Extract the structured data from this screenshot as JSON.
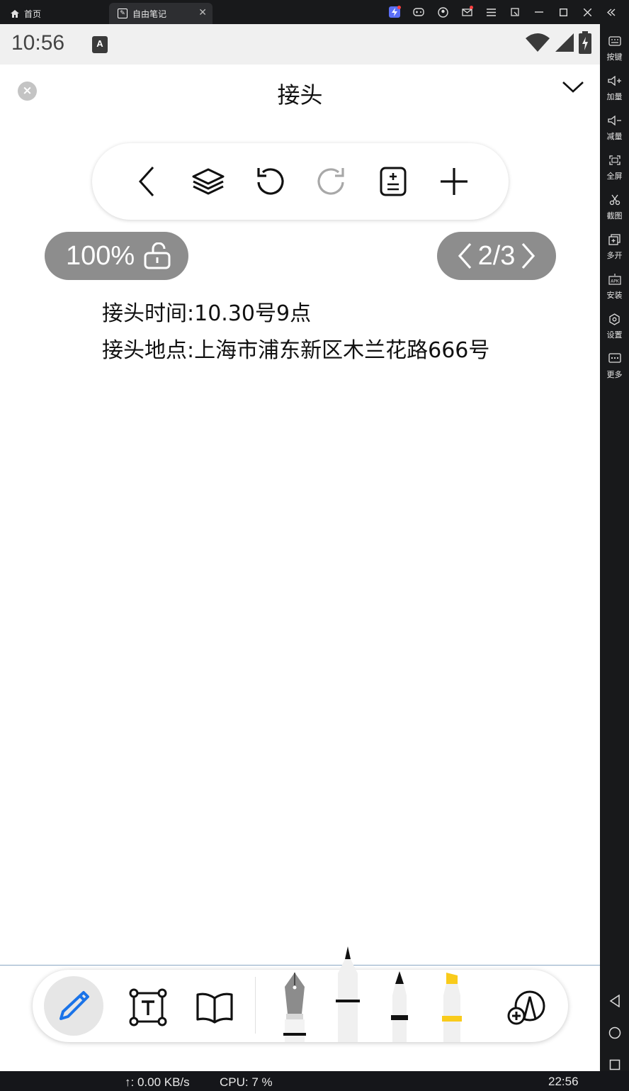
{
  "emulator": {
    "tabs": [
      {
        "label": "首页"
      },
      {
        "label": "自由笔记",
        "close": "✕"
      }
    ],
    "sidebar": [
      {
        "label": "按键",
        "icon": "keyboard-icon"
      },
      {
        "label": "加量",
        "icon": "volume-up-icon"
      },
      {
        "label": "减量",
        "icon": "volume-down-icon"
      },
      {
        "label": "全屏",
        "icon": "fullscreen-icon"
      },
      {
        "label": "截图",
        "icon": "scissors-icon"
      },
      {
        "label": "多开",
        "icon": "multi-instance-icon"
      },
      {
        "label": "安装",
        "icon": "apk-icon"
      },
      {
        "label": "设置",
        "icon": "settings-icon"
      },
      {
        "label": "更多",
        "icon": "more-icon"
      }
    ]
  },
  "statusbar": {
    "time": "10:56",
    "notif_icon_letter": "A"
  },
  "note": {
    "title": "接头",
    "lines": [
      "接头时间:10.30号9点",
      "接头地点:上海市浦东新区木兰花路666号"
    ]
  },
  "toolbar": {
    "icons": [
      "back-icon",
      "layers-icon",
      "undo-icon",
      "redo-icon",
      "page-settings-icon",
      "add-icon"
    ]
  },
  "zoom": {
    "value": "100%"
  },
  "pager": {
    "value": "2/3"
  },
  "pen_bar": {
    "tools": [
      "pencil-icon",
      "text-box-icon",
      "book-icon",
      "fountain-pen-icon",
      "brush-pen-icon",
      "marker-pen-icon",
      "highlighter-icon",
      "add-pen-icon"
    ],
    "highlighter_color": "#f9cb1b",
    "active_color": "#1a73e8"
  },
  "taskbar": {
    "net": "↑: 0.00 KB/s",
    "cpu": "CPU: 7 %",
    "clock": "22:56"
  }
}
